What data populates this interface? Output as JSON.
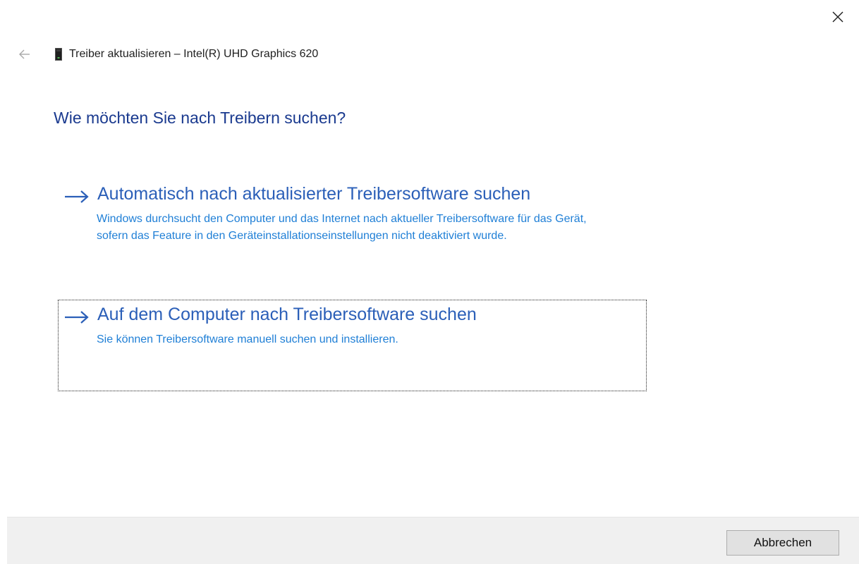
{
  "window": {
    "title": "Treiber aktualisieren – Intel(R) UHD Graphics 620"
  },
  "heading": "Wie möchten Sie nach Treibern suchen?",
  "options": [
    {
      "title": "Automatisch nach aktualisierter Treibersoftware suchen",
      "description": "Windows durchsucht den Computer und das Internet nach aktueller Treibersoftware für das Gerät, sofern das Feature in den Geräteinstallationseinstellungen nicht deaktiviert wurde."
    },
    {
      "title": "Auf dem Computer nach Treibersoftware suchen",
      "description": "Sie können Treibersoftware manuell suchen und installieren."
    }
  ],
  "footer": {
    "cancel_label": "Abbrechen"
  },
  "icons": {
    "close": "close-icon",
    "back": "back-arrow-icon",
    "device": "graphics-device-icon",
    "option_arrow": "arrow-right-icon"
  },
  "colors": {
    "heading": "#1a3a8f",
    "option_title": "#2b5fb8",
    "option_description": "#1f7fd6",
    "footer_bg": "#f0f0f0"
  }
}
